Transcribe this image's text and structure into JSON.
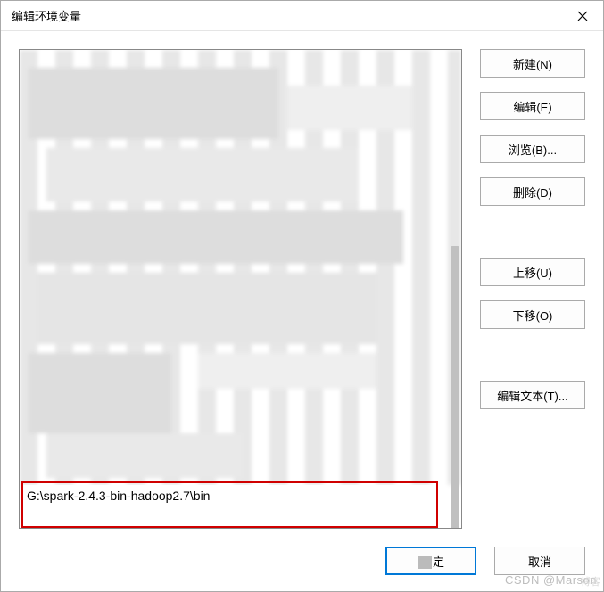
{
  "titlebar": {
    "title": "编辑环境变量"
  },
  "list": {
    "visible_entry": "G:\\spark-2.4.3-bin-hadoop2.7\\bin"
  },
  "buttons": {
    "new": "新建(N)",
    "edit": "编辑(E)",
    "browse": "浏览(B)...",
    "delete": "删除(D)",
    "move_up": "上移(U)",
    "move_down": "下移(O)",
    "edit_text": "编辑文本(T)..."
  },
  "footer": {
    "ok_suffix": "定",
    "cancel": "取消"
  },
  "watermark": "CSDN @Marson",
  "watermark2": "博客"
}
